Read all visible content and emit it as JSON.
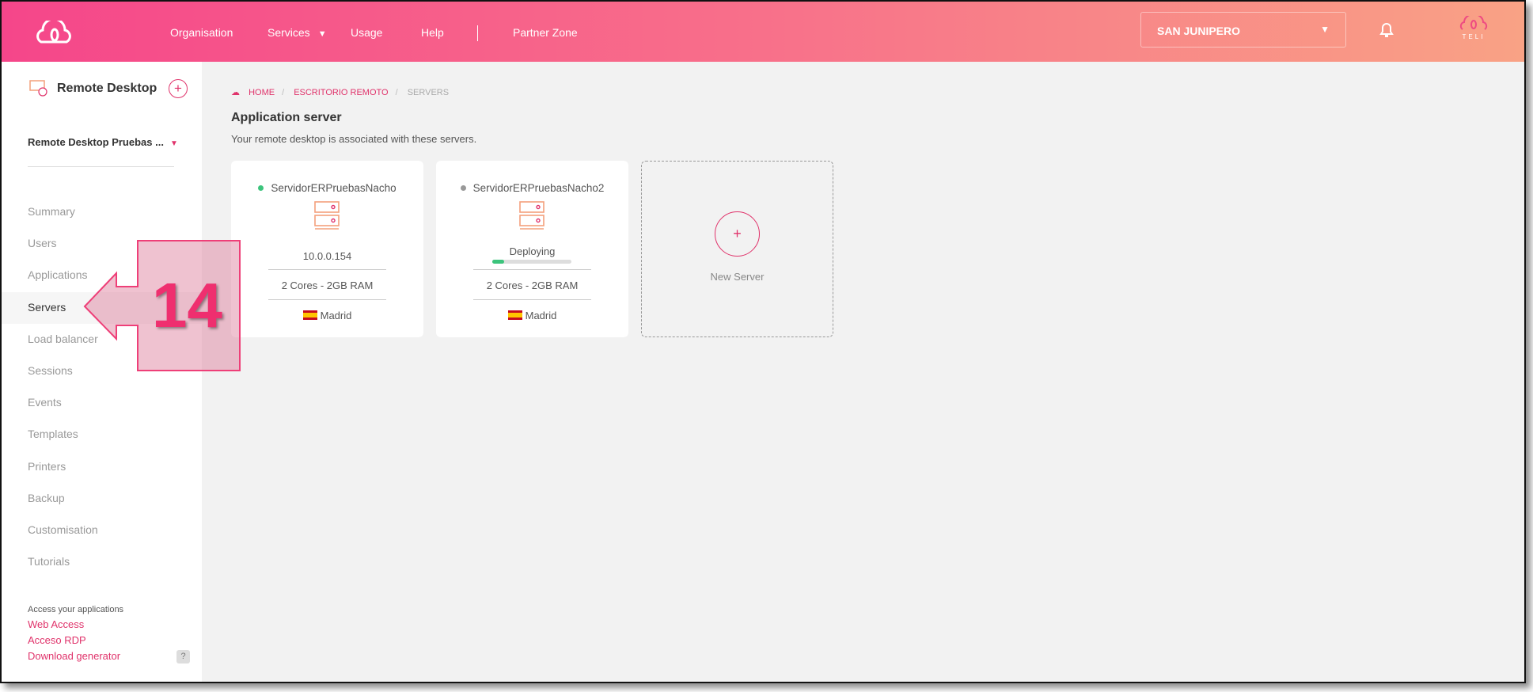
{
  "header": {
    "nav": [
      "Organisation",
      "Services",
      "Usage",
      "Help",
      "Partner Zone"
    ],
    "organisation": "SAN JUNIPERO",
    "brand_text": "TELI"
  },
  "sidebar": {
    "title": "Remote Desktop",
    "selector": "Remote Desktop Pruebas ...",
    "items": [
      "Summary",
      "Users",
      "Applications",
      "Servers",
      "Load balancer",
      "Sessions",
      "Events",
      "Templates",
      "Printers",
      "Backup",
      "Customisation",
      "Tutorials"
    ],
    "active": "Servers",
    "access_label": "Access your applications",
    "links": [
      "Web Access",
      "Acceso RDP",
      "Download generator"
    ],
    "help": "?"
  },
  "breadcrumb": [
    "HOME",
    "ESCRITORIO REMOTO",
    "SERVERS"
  ],
  "main": {
    "title": "Application server",
    "description": "Your remote desktop is associated with these servers.",
    "servers": [
      {
        "name": "ServidorERPruebasNacho",
        "status_color": "#3cc47c",
        "ip": "10.0.0.154",
        "specs": "2 Cores - 2GB RAM",
        "location": "Madrid"
      },
      {
        "name": "ServidorERPruebasNacho2",
        "status_color": "#999999",
        "status": "Deploying",
        "progress": 0.15,
        "specs": "2 Cores - 2GB RAM",
        "location": "Madrid"
      }
    ],
    "new_server": "New Server"
  },
  "callout": {
    "number": "14"
  },
  "colors": {
    "accent": "#e0336b",
    "header_start": "#f5468a",
    "header_end": "#f9a285",
    "server_icon": "#f4a07c"
  }
}
